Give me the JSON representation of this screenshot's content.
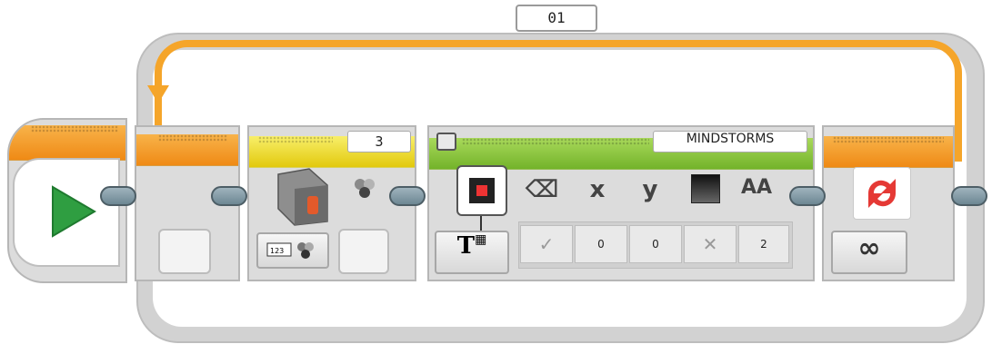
{
  "loop": {
    "label": "01",
    "count_symbol": "∞"
  },
  "display_block": {
    "text_field": "MINDSTORMS",
    "params": {
      "clear": "✓",
      "x": "0",
      "y": "0",
      "color": "✕",
      "font": "2"
    }
  },
  "sensor_block": {
    "port": "3"
  },
  "icons": {
    "x_label": "x",
    "y_label": "y",
    "font_label": "AA"
  }
}
